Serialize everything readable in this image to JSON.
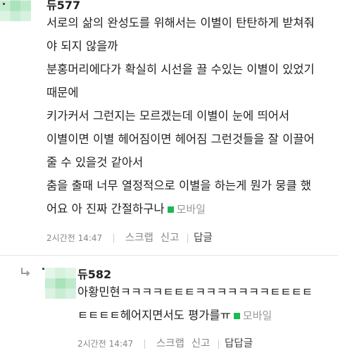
{
  "comments": [
    {
      "nickname": "듀577",
      "lines": [
        "서로의 삶의 완성도를 위해서는 이별이 탄탄하게 받쳐줘",
        "야 되지 않을까",
        "분홍머리에다가 확실히 시선을 끌 수있는 이별이 있었기",
        "때문에",
        "키가커서 그런지는 모르겠는데 이별이 눈에 띄어서",
        "이별이면 이별 헤어짐이면 헤어짐 그런것들을 잘 이끌어",
        "줄 수 있을것 같아서",
        "춤을 출때 너무 열정적으로 이별을 하는게 뭔가 뭉클 했",
        "어요 아 진짜 간절하구나"
      ],
      "mobile_label": "모바일",
      "time": "2시간전 14:47",
      "scrap": "스크랩",
      "report": "신고",
      "reply": "답글"
    },
    {
      "nickname": "듀582",
      "lines": [
        "아황민현ㅋㅋㅋㅋㅌㅌㅌㅋㅋㅋㅋㅋㅋㅋㅌㅌㅌㅌ",
        "ㅌㅌㅌㅌ헤어지면서도 평가를ㅠ"
      ],
      "mobile_label": "모바일",
      "time": "2시간전 14:47",
      "scrap": "스크랩",
      "report": "신고",
      "reply": "답답글"
    }
  ],
  "colors": {
    "mobile_mark": "#1db954",
    "meta_text": "#888888"
  },
  "icons": {
    "reply_indicator": "reply-arrow-icon"
  }
}
